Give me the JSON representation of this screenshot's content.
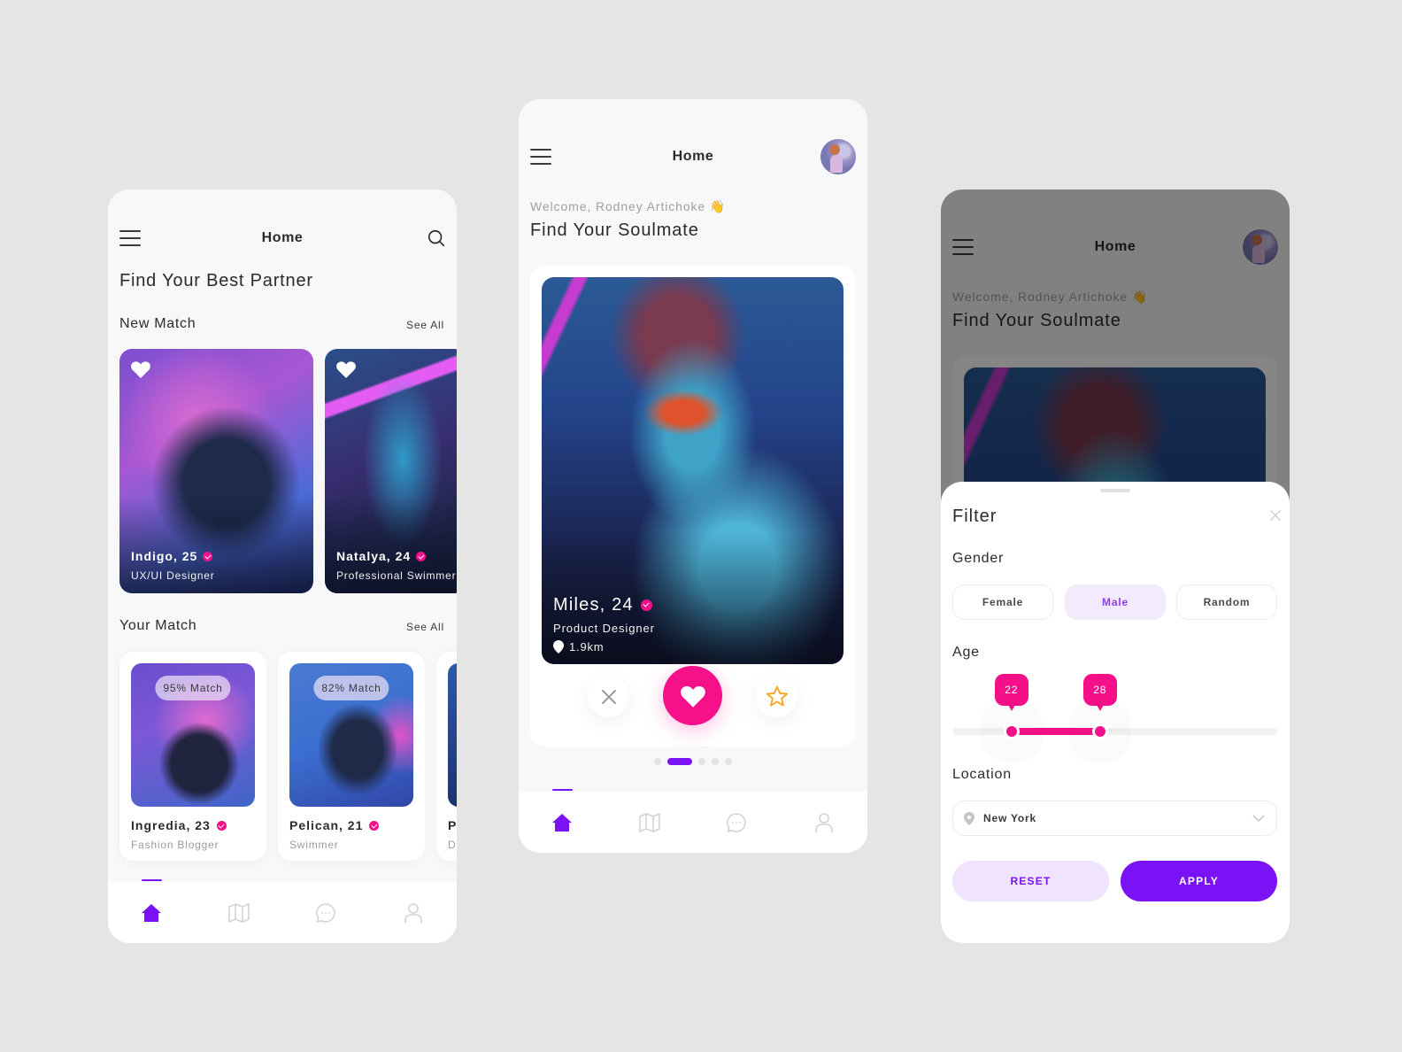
{
  "colors": {
    "accent": "#7a12f5",
    "pink": "#f5108a",
    "star": "#f5a623",
    "background": "#e5e5e6"
  },
  "screen1": {
    "header": {
      "title": "Home",
      "menu_icon": "hamburger-icon",
      "search_icon": "search-icon"
    },
    "heading": "Find Your Best Partner",
    "new_match": {
      "title": "New Match",
      "see_all": "See All",
      "cards": [
        {
          "name": "Indigo, 25",
          "role": "UX/UI Designer",
          "favorite": true,
          "verified": true
        },
        {
          "name": "Natalya, 24",
          "role": "Professional Swimmer",
          "favorite": true,
          "verified": true
        }
      ]
    },
    "your_match": {
      "title": "Your Match",
      "see_all": "See All",
      "cards": [
        {
          "name": "Ingredia, 23",
          "role": "Fashion Blogger",
          "match": "95% Match",
          "verified": true
        },
        {
          "name": "Pelican, 21",
          "role": "Swimmer",
          "match": "82% Match",
          "verified": true
        },
        {
          "name": "P",
          "role": "D",
          "match": "",
          "verified": false
        }
      ]
    },
    "bottom_nav": [
      {
        "name": "home",
        "icon": "home-icon",
        "active": true
      },
      {
        "name": "map",
        "icon": "map-icon",
        "active": false
      },
      {
        "name": "chat",
        "icon": "chat-icon",
        "active": false
      },
      {
        "name": "profile",
        "icon": "user-icon",
        "active": false
      }
    ]
  },
  "screen2": {
    "header": {
      "title": "Home",
      "menu_icon": "hamburger-icon",
      "avatar": "user-avatar"
    },
    "welcome": "Welcome, Rodney Artichoke 👋",
    "heading": "Find Your Soulmate",
    "profile": {
      "name": "Miles, 24",
      "role": "Product Designer",
      "distance": "1.9km",
      "verified": true
    },
    "actions": [
      {
        "name": "dislike",
        "icon": "close-icon"
      },
      {
        "name": "like",
        "icon": "heart-icon"
      },
      {
        "name": "super-like",
        "icon": "star-icon"
      }
    ],
    "pager": {
      "count": 5,
      "active": 2
    },
    "bottom_nav_active": "home"
  },
  "screen3": {
    "header": {
      "title": "Home"
    },
    "welcome": "Welcome, Rodney Artichoke 👋",
    "heading": "Find Your Soulmate",
    "filter": {
      "title": "Filter",
      "gender_label": "Gender",
      "gender_options": [
        "Female",
        "Male",
        "Random"
      ],
      "gender_selected": "Male",
      "age_label": "Age",
      "age_min": 22,
      "age_max": 28,
      "age_range": [
        18,
        40
      ],
      "location_label": "Location",
      "location_value": "New York",
      "reset_label": "RESET",
      "apply_label": "APPLY"
    }
  }
}
